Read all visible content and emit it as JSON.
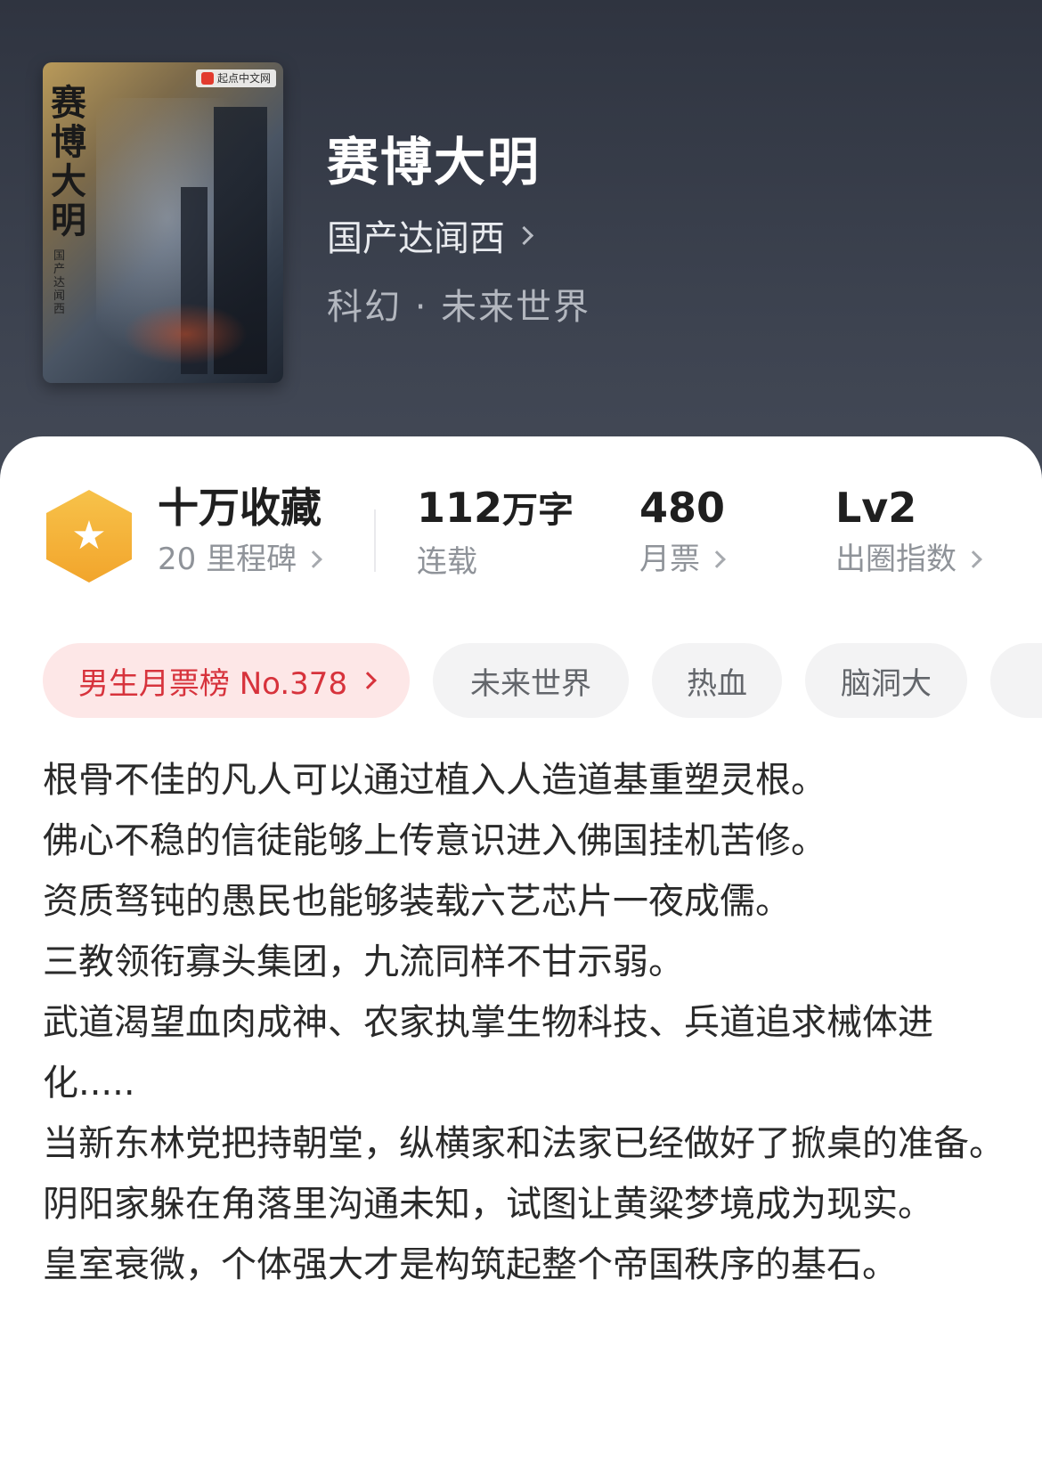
{
  "book": {
    "cover_title": "赛博大明",
    "cover_author": "国产达闻西",
    "cover_badge": "起点中文网",
    "title": "赛博大明",
    "author": "国产达闻西",
    "genre": "科幻 · 未来世界"
  },
  "stats": {
    "collect": {
      "value": "十万收藏",
      "label": "20 里程碑"
    },
    "words": {
      "value": "112",
      "unit": "万字",
      "label": "连载"
    },
    "tickets": {
      "value": "480",
      "label": "月票"
    },
    "level": {
      "value": "Lv2",
      "label": "出圈指数"
    }
  },
  "tags": {
    "rank": "男生月票榜 No.378",
    "items": [
      "未来世界",
      "热血",
      "脑洞大"
    ]
  },
  "description": [
    "根骨不佳的凡人可以通过植入人造道基重塑灵根。",
    "佛心不稳的信徒能够上传意识进入佛国挂机苦修。",
    "资质驽钝的愚民也能够装载六艺芯片一夜成儒。",
    "三教领衔寡头集团，九流同样不甘示弱。",
    "武道渴望血肉成神、农家执掌生物科技、兵道追求械体进化.....",
    "当新东林党把持朝堂，纵横家和法家已经做好了掀桌的准备。",
    "阴阳家躲在角落里沟通未知，试图让黄粱梦境成为现实。",
    "皇室衰微，个体强大才是构筑起整个帝国秩序的基石。"
  ],
  "colors": {
    "header_bg": "#363b47",
    "accent_red": "#d7333c",
    "badge_orange": "#f2a52c"
  },
  "icons": [
    "star-hexagon-icon",
    "chevron-right-icon"
  ]
}
